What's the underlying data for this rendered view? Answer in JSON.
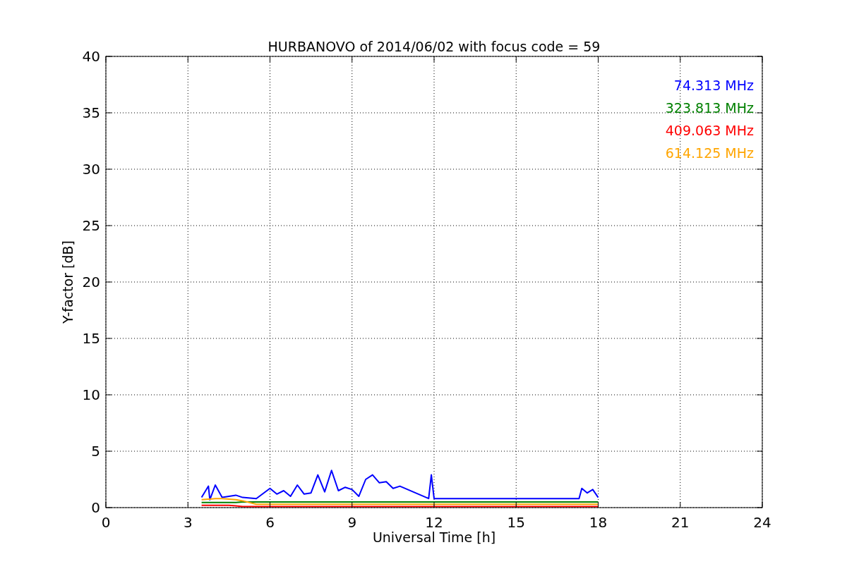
{
  "figure": {
    "chart_data": {
      "type": "line",
      "title": "HURBANOVO of 2014/06/02 with focus code = 59",
      "xlabel": "Universal Time [h]",
      "ylabel": "Y-factor [dB]",
      "x": [
        3.5,
        3.75,
        3.8,
        4,
        4.25,
        4.5,
        4.75,
        5,
        5.5,
        6,
        6.25,
        6.5,
        6.75,
        7,
        7.25,
        7.5,
        7.75,
        8,
        8.25,
        8.5,
        8.75,
        9,
        9.25,
        9.5,
        9.75,
        10,
        10.25,
        10.5,
        10.75,
        11.8,
        11.9,
        12,
        17.3,
        17.4,
        17.6,
        17.8,
        18
      ],
      "series": [
        {
          "name": "74.313 MHz",
          "color": "#0000ff",
          "values": [
            0.9,
            1.9,
            0.7,
            2.0,
            0.9,
            1.0,
            1.1,
            0.9,
            0.8,
            1.7,
            1.2,
            1.5,
            1.0,
            2.0,
            1.2,
            1.3,
            2.9,
            1.4,
            3.3,
            1.5,
            1.8,
            1.6,
            1.0,
            2.5,
            2.9,
            2.2,
            2.3,
            1.7,
            1.9,
            0.8,
            2.9,
            0.8,
            0.8,
            1.7,
            1.3,
            1.6,
            0.9
          ]
        },
        {
          "name": "323.813 MHz",
          "color": "#008000",
          "values": [
            0.45,
            0.45,
            0.45,
            0.45,
            0.45,
            0.45,
            0.45,
            0.5,
            0.5,
            0.5,
            0.5,
            0.5,
            0.5,
            0.5,
            0.5,
            0.5,
            0.5,
            0.5,
            0.5,
            0.5,
            0.5,
            0.5,
            0.5,
            0.5,
            0.5,
            0.5,
            0.5,
            0.5,
            0.5,
            0.5,
            0.5,
            0.5,
            0.5,
            0.5,
            0.5,
            0.5,
            0.5
          ]
        },
        {
          "name": "409.063 MHz",
          "color": "#ff0000",
          "values": [
            0.2,
            0.2,
            0.2,
            0.2,
            0.2,
            0.2,
            0.15,
            0.1,
            0.1,
            0.1,
            0.1,
            0.1,
            0.1,
            0.1,
            0.1,
            0.1,
            0.1,
            0.1,
            0.1,
            0.1,
            0.1,
            0.1,
            0.1,
            0.1,
            0.1,
            0.1,
            0.1,
            0.1,
            0.1,
            0.1,
            0.1,
            0.1,
            0.1,
            0.1,
            0.1,
            0.1,
            0.1
          ]
        },
        {
          "name": "614.125 MHz",
          "color": "#ffa500",
          "values": [
            0.7,
            0.75,
            0.75,
            0.8,
            0.8,
            0.75,
            0.7,
            0.6,
            0.3,
            0.3,
            0.3,
            0.3,
            0.3,
            0.3,
            0.3,
            0.3,
            0.3,
            0.3,
            0.3,
            0.3,
            0.3,
            0.3,
            0.3,
            0.3,
            0.3,
            0.3,
            0.3,
            0.3,
            0.3,
            0.3,
            0.3,
            0.3,
            0.3,
            0.3,
            0.3,
            0.3,
            0.3
          ]
        }
      ],
      "grid": true,
      "xlim": [
        0,
        24
      ],
      "ylim": [
        0,
        40
      ],
      "xticks": [
        0,
        3,
        6,
        9,
        12,
        15,
        18,
        21,
        24
      ],
      "yticks": [
        0,
        5,
        10,
        15,
        20,
        25,
        30,
        35,
        40
      ]
    }
  }
}
